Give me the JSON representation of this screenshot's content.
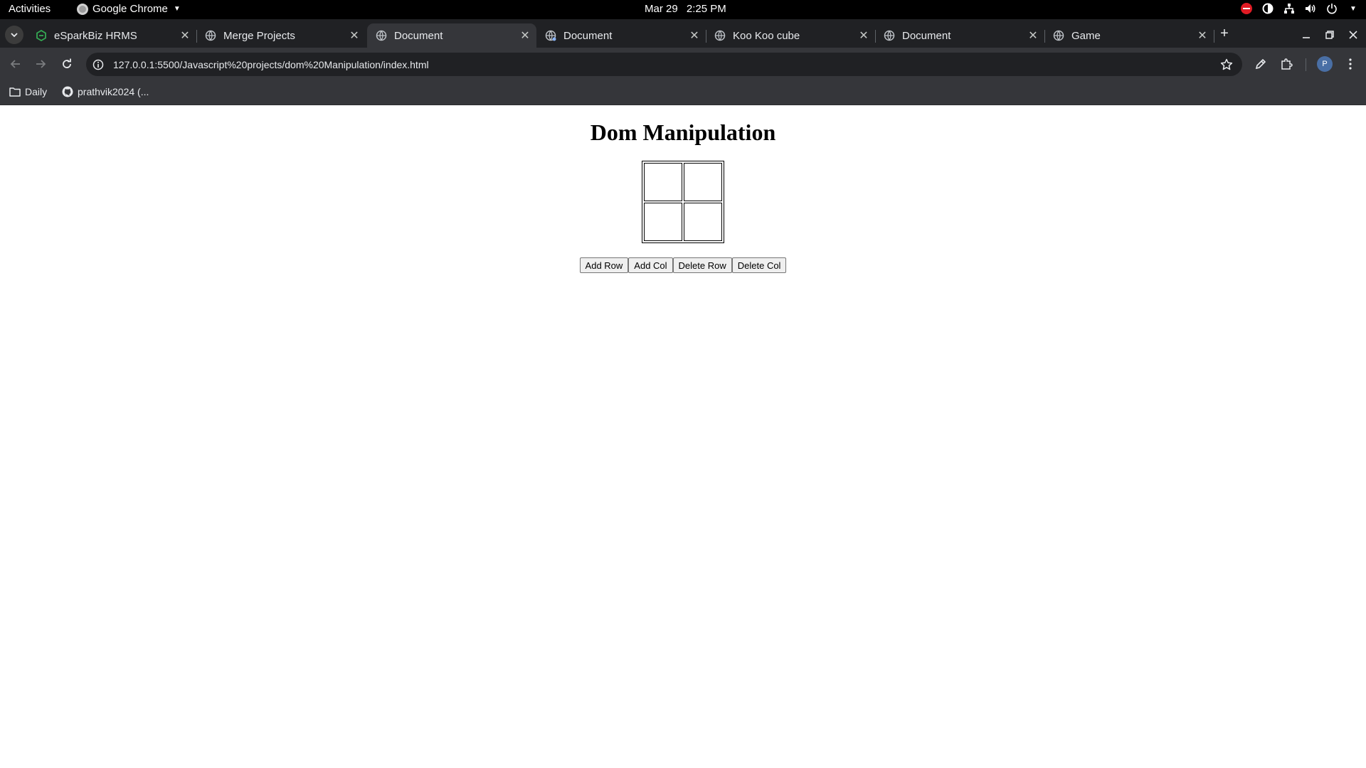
{
  "topbar": {
    "activities": "Activities",
    "app_name": "Google Chrome",
    "date": "Mar 29",
    "time": "2:25 PM"
  },
  "tabs": [
    {
      "title": "eSparkBiz HRMS",
      "icon": "esparkbiz-favicon",
      "active": false
    },
    {
      "title": "Merge Projects",
      "icon": "globe-icon",
      "active": false
    },
    {
      "title": "Document",
      "icon": "globe-icon",
      "active": true
    },
    {
      "title": "Document",
      "icon": "globe-icon",
      "active": false
    },
    {
      "title": "Koo Koo cube",
      "icon": "globe-icon",
      "active": false
    },
    {
      "title": "Document",
      "icon": "globe-icon",
      "active": false
    },
    {
      "title": "Game",
      "icon": "globe-icon",
      "active": false
    }
  ],
  "toolbar": {
    "url": "127.0.0.1:5500/Javascript%20projects/dom%20Manipulation/index.html",
    "avatar_initial": "P"
  },
  "bookmarks": [
    {
      "label": "Daily",
      "icon": "folder-icon"
    },
    {
      "label": "prathvik2024 (...",
      "icon": "github-icon"
    }
  ],
  "page": {
    "heading": "Dom Manipulation",
    "grid": {
      "rows": 2,
      "cols": 2
    },
    "buttons": [
      "Add Row",
      "Add Col",
      "Delete Row",
      "Delete Col"
    ]
  },
  "colors": {
    "tabstrip_bg": "#202124",
    "toolbar_bg": "#35363a",
    "dnd_red": "#e01b24"
  }
}
